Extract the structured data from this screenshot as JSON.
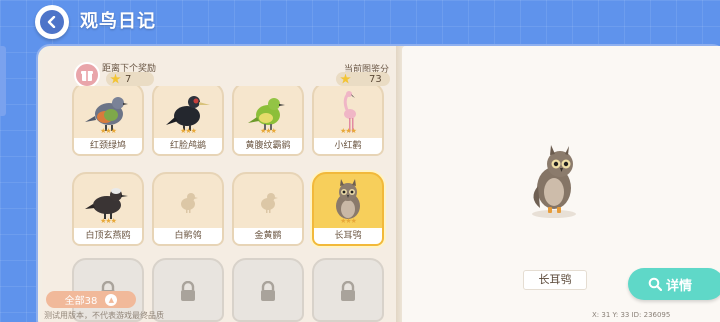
{
  "header": {
    "title": "观鸟日记"
  },
  "reward": {
    "label": "距离下个奖励",
    "value": "7"
  },
  "score": {
    "label": "当前图鉴分",
    "value": "73"
  },
  "birds": [
    {
      "name": "红颈绿鸠",
      "state": "found",
      "stars": "★★★"
    },
    {
      "name": "红脸鸬鹚",
      "state": "found",
      "stars": "★★★"
    },
    {
      "name": "黄腹纹霸鹟",
      "state": "found",
      "stars": "★★★"
    },
    {
      "name": "小红鹳",
      "state": "found",
      "stars": "★★★"
    },
    {
      "name": "白顶玄燕鸥",
      "state": "found",
      "stars": "★★★"
    },
    {
      "name": "白鹡鸰",
      "state": "unknown"
    },
    {
      "name": "金黄鹂",
      "state": "unknown"
    },
    {
      "name": "长耳鸮",
      "state": "selected",
      "stars": "★★★"
    }
  ],
  "footer": {
    "total": "全部38",
    "watermark": "测试用版本，不代表游戏最终品质"
  },
  "detail": {
    "bird_name": "长耳鸮",
    "button_label": "详情",
    "coords": "X: 31  Y: 33  ID: 236095"
  }
}
